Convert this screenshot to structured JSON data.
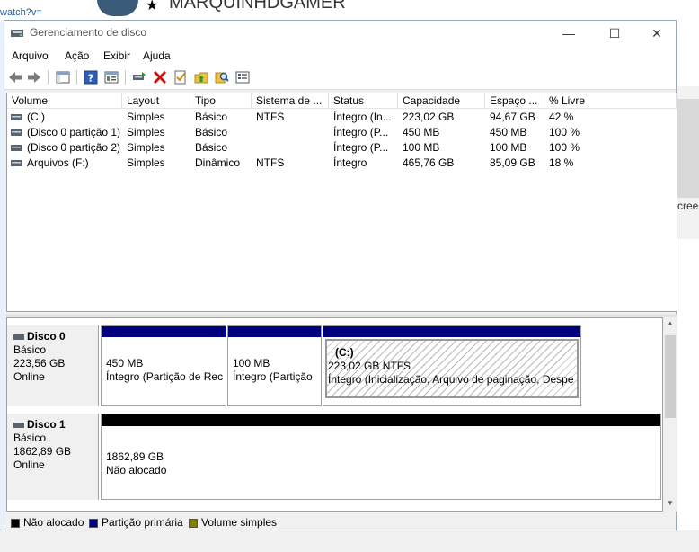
{
  "background": {
    "url_fragment": "watch?v=",
    "heading": "MARQUINHDGAMER",
    "right_text": "cree"
  },
  "window": {
    "title": "Gerenciamento de disco",
    "controls": {
      "minimize": "—",
      "maximize": "☐",
      "close": "✕"
    }
  },
  "menu": [
    "Arquivo",
    "Ação",
    "Exibir",
    "Ajuda"
  ],
  "toolbar": [
    "back-arrow",
    "forward-arrow",
    "console-tree",
    "help",
    "properties",
    "connect",
    "delete",
    "checklist",
    "new-folder",
    "search",
    "list-view"
  ],
  "volume_list": {
    "columns": [
      "Volume",
      "Layout",
      "Tipo",
      "Sistema de ...",
      "Status",
      "Capacidade",
      "Espaço ...",
      "% Livre"
    ],
    "rows": [
      {
        "volume": "(C:)",
        "layout": "Simples",
        "tipo": "Básico",
        "sistema": "NTFS",
        "status": "Íntegro (In...",
        "capacidade": "223,02 GB",
        "espaco": "94,67 GB",
        "livre": "42 %"
      },
      {
        "volume": "(Disco 0 partição 1)",
        "layout": "Simples",
        "tipo": "Básico",
        "sistema": "",
        "status": "Íntegro (P...",
        "capacidade": "450 MB",
        "espaco": "450 MB",
        "livre": "100 %"
      },
      {
        "volume": "(Disco 0 partição 2)",
        "layout": "Simples",
        "tipo": "Básico",
        "sistema": "",
        "status": "Íntegro (P...",
        "capacidade": "100 MB",
        "espaco": "100 MB",
        "livre": "100 %"
      },
      {
        "volume": "Arquivos (F:)",
        "layout": "Simples",
        "tipo": "Dinâmico",
        "sistema": "NTFS",
        "status": "Íntegro",
        "capacidade": "465,76 GB",
        "espaco": "85,09 GB",
        "livre": "18 %"
      }
    ]
  },
  "disks": [
    {
      "name": "Disco 0",
      "type": "Básico",
      "size": "223,56 GB",
      "state": "Online",
      "partitions": [
        {
          "label": "",
          "size": "450 MB",
          "status": "Íntegro (Partição de Rec",
          "color": "#00007f"
        },
        {
          "label": "",
          "size": "100 MB",
          "status": "Íntegro (Partição",
          "color": "#00007f"
        },
        {
          "label": "(C:)",
          "size": "223,02 GB NTFS",
          "status": "Íntegro (Inicialização, Arquivo de paginação, Despe",
          "color": "#00007f"
        }
      ]
    },
    {
      "name": "Disco 1",
      "type": "Básico",
      "size": "1862,89 GB",
      "state": "Online",
      "partitions": [
        {
          "label": "",
          "size": "1862,89 GB",
          "status": "Não alocado",
          "color": "#000000"
        }
      ]
    }
  ],
  "legend": [
    {
      "label": "Não alocado",
      "color": "#000000"
    },
    {
      "label": "Partição primária",
      "color": "#00007f"
    },
    {
      "label": "Volume simples",
      "color": "#808000"
    }
  ]
}
